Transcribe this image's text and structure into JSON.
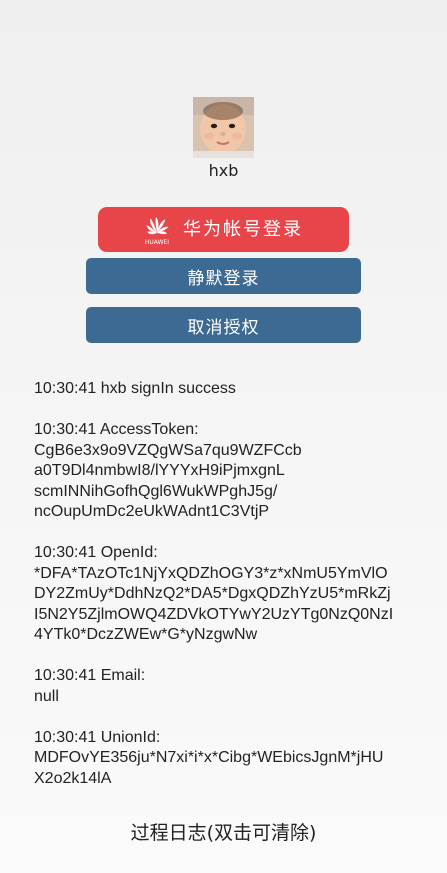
{
  "user": {
    "name": "hxb"
  },
  "buttons": {
    "huawei_login": "华为帐号登录",
    "huawei_logo_text": "HUAWEI",
    "silent_login": "静默登录",
    "revoke_auth": "取消授权"
  },
  "log": [
    "10:30:41 hxb signIn success",
    "10:30:41 AccessToken:\nCgB6e3x9o9VZQgWSa7qu9WZFCcb\na0T9Dl4nmbwI8/lYYYxH9iPjmxgnL\nscmINNihGofhQgl6WukWPghJ5g/\nncOupUmDc2eUkWAdnt1C3VtjP",
    "10:30:41 OpenId:\n*DFA*TAzOTc1NjYxQDZhOGY3*z*xNmU5YmVlO\nDY2ZmUy*DdhNzQ2*DA5*DgxQDZhYzU5*mRkZj\nI5N2Y5ZjlmOWQ4ZDVkOTYwY2UzYTg0NzQ0NzI\n4YTk0*DczZWEw*G*yNzgwNw",
    "10:30:41 Email:\nnull",
    "10:30:41 UnionId:\nMDFOvYE356ju*N7xi*i*x*Cibg*WEbicsJgnM*jHU\nX2o2k14lA"
  ],
  "footer": {
    "label": "过程日志(双击可清除)"
  },
  "colors": {
    "huawei_red": "#e8454a",
    "button_blue": "#3d6a92"
  },
  "icons": {
    "huawei": "huawei-logo-icon"
  }
}
